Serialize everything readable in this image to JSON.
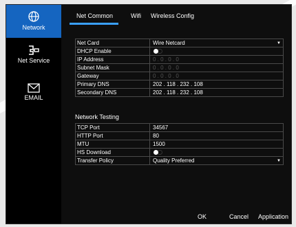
{
  "sidebar": {
    "items": [
      {
        "label": "Network",
        "icon": "globe-icon",
        "active": true
      },
      {
        "label": "Net Service",
        "icon": "net-service-icon",
        "active": false
      },
      {
        "label": "EMAIL",
        "icon": "envelope-icon",
        "active": false
      }
    ]
  },
  "tabs": [
    {
      "label": "Net Common",
      "active": true
    },
    {
      "label": "Wifi",
      "active": false
    },
    {
      "label": "Wireless Config",
      "active": false
    }
  ],
  "net_common": {
    "rows": [
      {
        "label": "Net Card",
        "value": "Wire Netcard"
      },
      {
        "label": "DHCP Enable",
        "value": ""
      },
      {
        "label": "IP Address",
        "value": "0   .   0   .   0   .   0"
      },
      {
        "label": "Subnet Mask",
        "value": "0   .   0   .   0   .   0"
      },
      {
        "label": "Gateway",
        "value": "0   .   0   .   0   .   0"
      },
      {
        "label": "Primary DNS",
        "value": "202  .  118  .  232  .  108"
      },
      {
        "label": "Secondary DNS",
        "value": "202  .  118  .  232  .  108"
      }
    ]
  },
  "network_testing": {
    "title": "Network Testing",
    "rows": [
      {
        "label": "TCP Port",
        "value": "34567"
      },
      {
        "label": "HTTP Port",
        "value": "80"
      },
      {
        "label": "MTU",
        "value": "1500"
      },
      {
        "label": "HS Download",
        "value": ""
      },
      {
        "label": "Transfer Policy",
        "value": "Quality Preferred"
      }
    ]
  },
  "buttons": {
    "ok": "OK",
    "cancel": "Cancel",
    "apply": "Application"
  },
  "colors": {
    "accent": "#1565c0",
    "tab_underline": "#3aa0ff",
    "background": "#0e0e0e"
  }
}
